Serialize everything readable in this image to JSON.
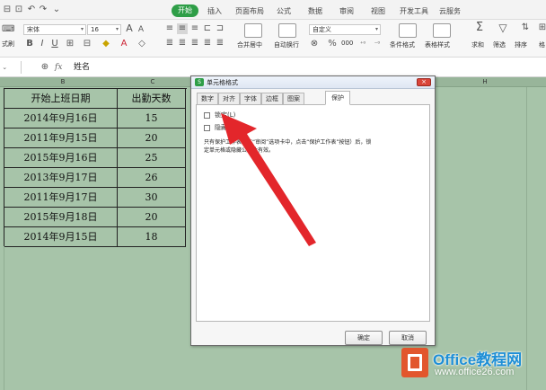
{
  "tabs": [
    "开始",
    "插入",
    "页面布局",
    "公式",
    "数据",
    "审阅",
    "视图",
    "开发工具",
    "云服务"
  ],
  "active_tab": "开始",
  "ribbon": {
    "paste_partial": "式刷",
    "font_name": "宋体",
    "font_size": "16",
    "grow_font": "A",
    "shrink_font": "A",
    "bold": "B",
    "italic": "I",
    "underline": "U",
    "merge_center": "合并居中",
    "wrap_text": "自动换行",
    "number_format": "自定义",
    "percent": "%",
    "thousands": "000",
    "cond_format": "条件格式",
    "table_style": "表格样式",
    "sum": "求和",
    "filter": "筛选",
    "sort": "排序",
    "format_partial": "格"
  },
  "formula_bar": {
    "fx": "fx",
    "content": "姓名"
  },
  "columns": [
    "B",
    "C",
    "H"
  ],
  "table": {
    "headers": [
      "开始上班日期",
      "出勤天数"
    ],
    "rows": [
      [
        "2014年9月16日",
        "15"
      ],
      [
        "2011年9月15日",
        "20"
      ],
      [
        "2015年9月16日",
        "25"
      ],
      [
        "2013年9月17日",
        "26"
      ],
      [
        "2011年9月17日",
        "30"
      ],
      [
        "2015年9月18日",
        "20"
      ],
      [
        "2014年9月15日",
        "18"
      ]
    ]
  },
  "dialog": {
    "title": "单元格格式",
    "tabs": [
      "数字",
      "对齐",
      "字体",
      "边框",
      "图案",
      "保护"
    ],
    "active_tab": "保护",
    "lock_label": "锁定(L)",
    "hide_label": "隐藏(I)",
    "info_line1": "只有保护工作表（在“审阅”选项卡中，点击“保护工作表”按钮）后，锁",
    "info_line2": "定单元格或隐藏公式才有效。",
    "ok": "确定",
    "cancel": "取消"
  },
  "watermark": {
    "brand": "Office教程网",
    "url": "www.office26.com"
  },
  "colors": {
    "accent_green": "#2e9e47",
    "sheet_green": "#a7c4a9",
    "arrow_red": "#e3262b",
    "watermark_orange": "#e2562d",
    "watermark_blue": "#1f8fd6"
  }
}
